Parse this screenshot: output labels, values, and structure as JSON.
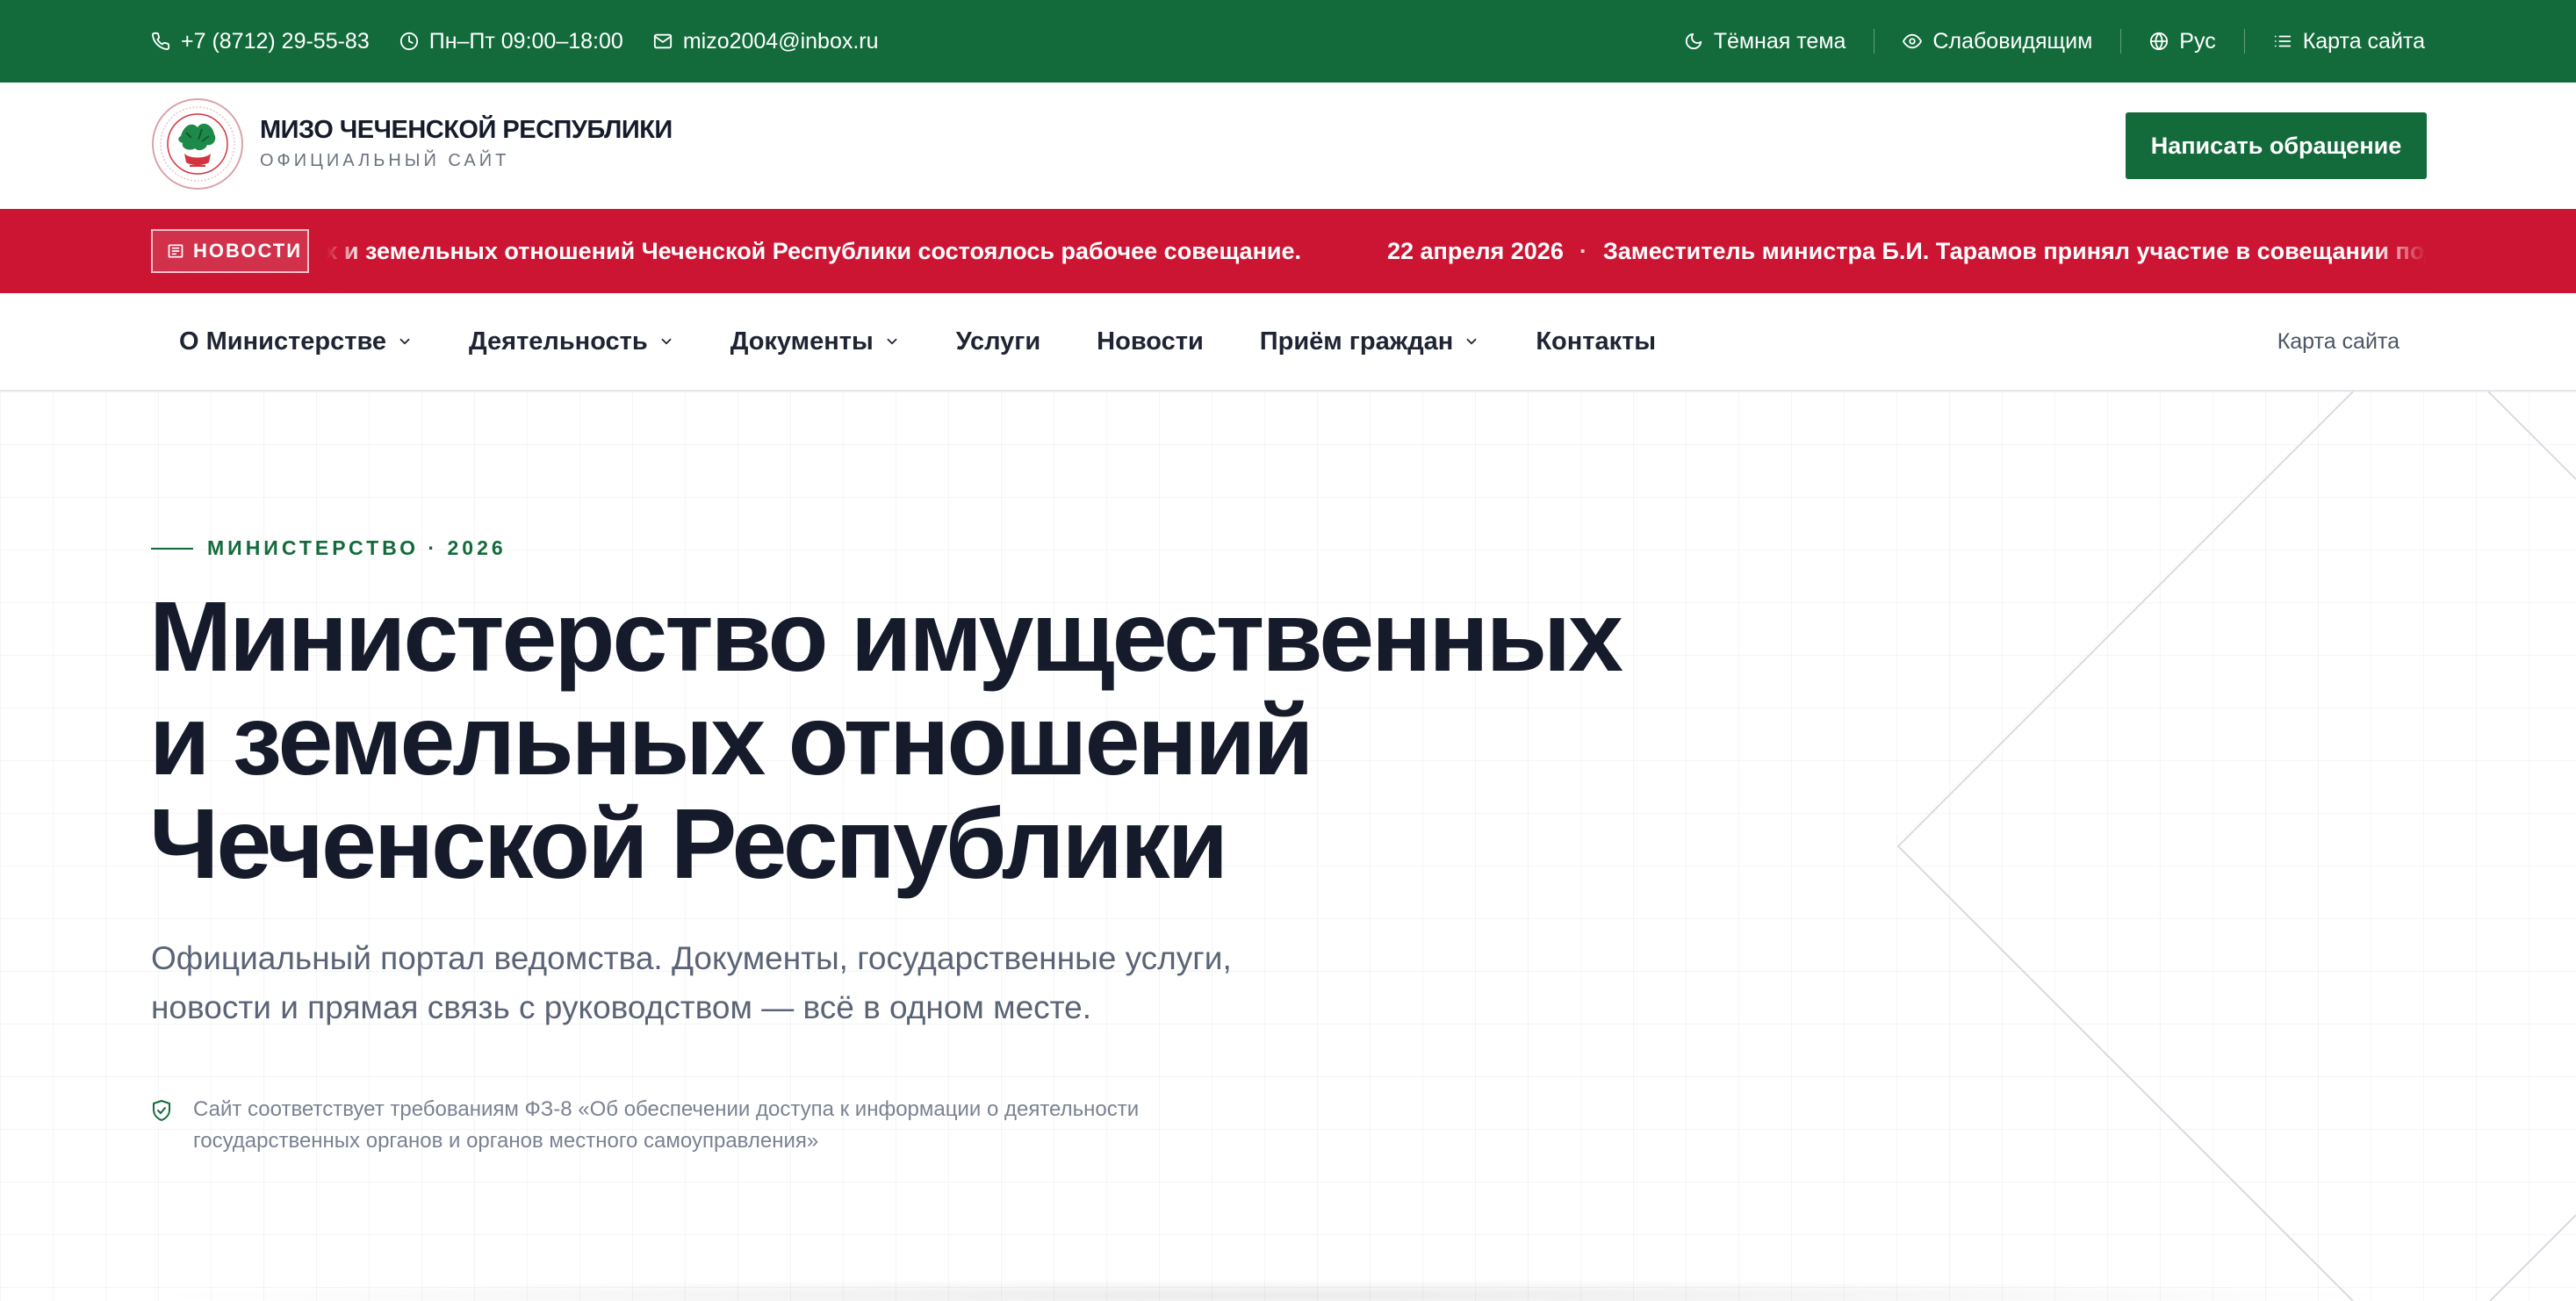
{
  "topbar": {
    "phone": "+7 (8712) 29-55-83",
    "hours": "Пн–Пт 09:00–18:00",
    "email": "mizo2004@inbox.ru",
    "dark_theme": "Тёмная тема",
    "low_vision": "Слабовидящим",
    "language": "Рус",
    "sitemap": "Карта сайта",
    "icons": [
      "phone-icon",
      "clock-icon",
      "mail-icon",
      "moon-icon",
      "eye-icon",
      "globe-icon",
      "list-icon"
    ]
  },
  "header": {
    "org_name": "МИЗО ЧЕЧЕНСКОЙ РЕСПУБЛИКИ",
    "org_sub": "ОФИЦИАЛЬНЫЙ САЙТ",
    "cta_label": "Написать обращение"
  },
  "ticker": {
    "badge": "НОВОСТИ",
    "items": [
      {
        "text": "Министерства имущественных и земельных отношений Чеченской Республики состоялось рабочее совещание."
      },
      {
        "date": "22 апреля 2026",
        "text": "Заместитель министра Б.И. Тарамов принял участие в совещании под председательством"
      }
    ]
  },
  "nav": {
    "items": [
      {
        "label": "О Министерстве",
        "dropdown": true
      },
      {
        "label": "Деятельность",
        "dropdown": true
      },
      {
        "label": "Документы",
        "dropdown": true
      },
      {
        "label": "Услуги",
        "dropdown": false
      },
      {
        "label": "Новости",
        "dropdown": false
      },
      {
        "label": "Приём граждан",
        "dropdown": true
      },
      {
        "label": "Контакты",
        "dropdown": false
      }
    ],
    "sitemap": "Карта сайта"
  },
  "hero": {
    "eyebrow": "МИНИСТЕРСТВО · 2026",
    "title_lines": [
      "Министерство имущественных",
      "и земельных отношений",
      "Чеченской Республики"
    ],
    "desc_lines": [
      "Официальный портал ведомства. Документы, государственные услуги,",
      "новости и прямая связь с руководством — всё в одном месте."
    ],
    "compliance_lines": [
      "Сайт соответствует требованиям ФЗ-8 «Об обеспечении доступа к информации о деятельности",
      "государственных органов и органов местного самоуправления»"
    ]
  },
  "colors": {
    "brand_green": "#136b3c",
    "news_red": "#cc1533",
    "heading": "#161b2b",
    "muted": "#5b6476"
  }
}
